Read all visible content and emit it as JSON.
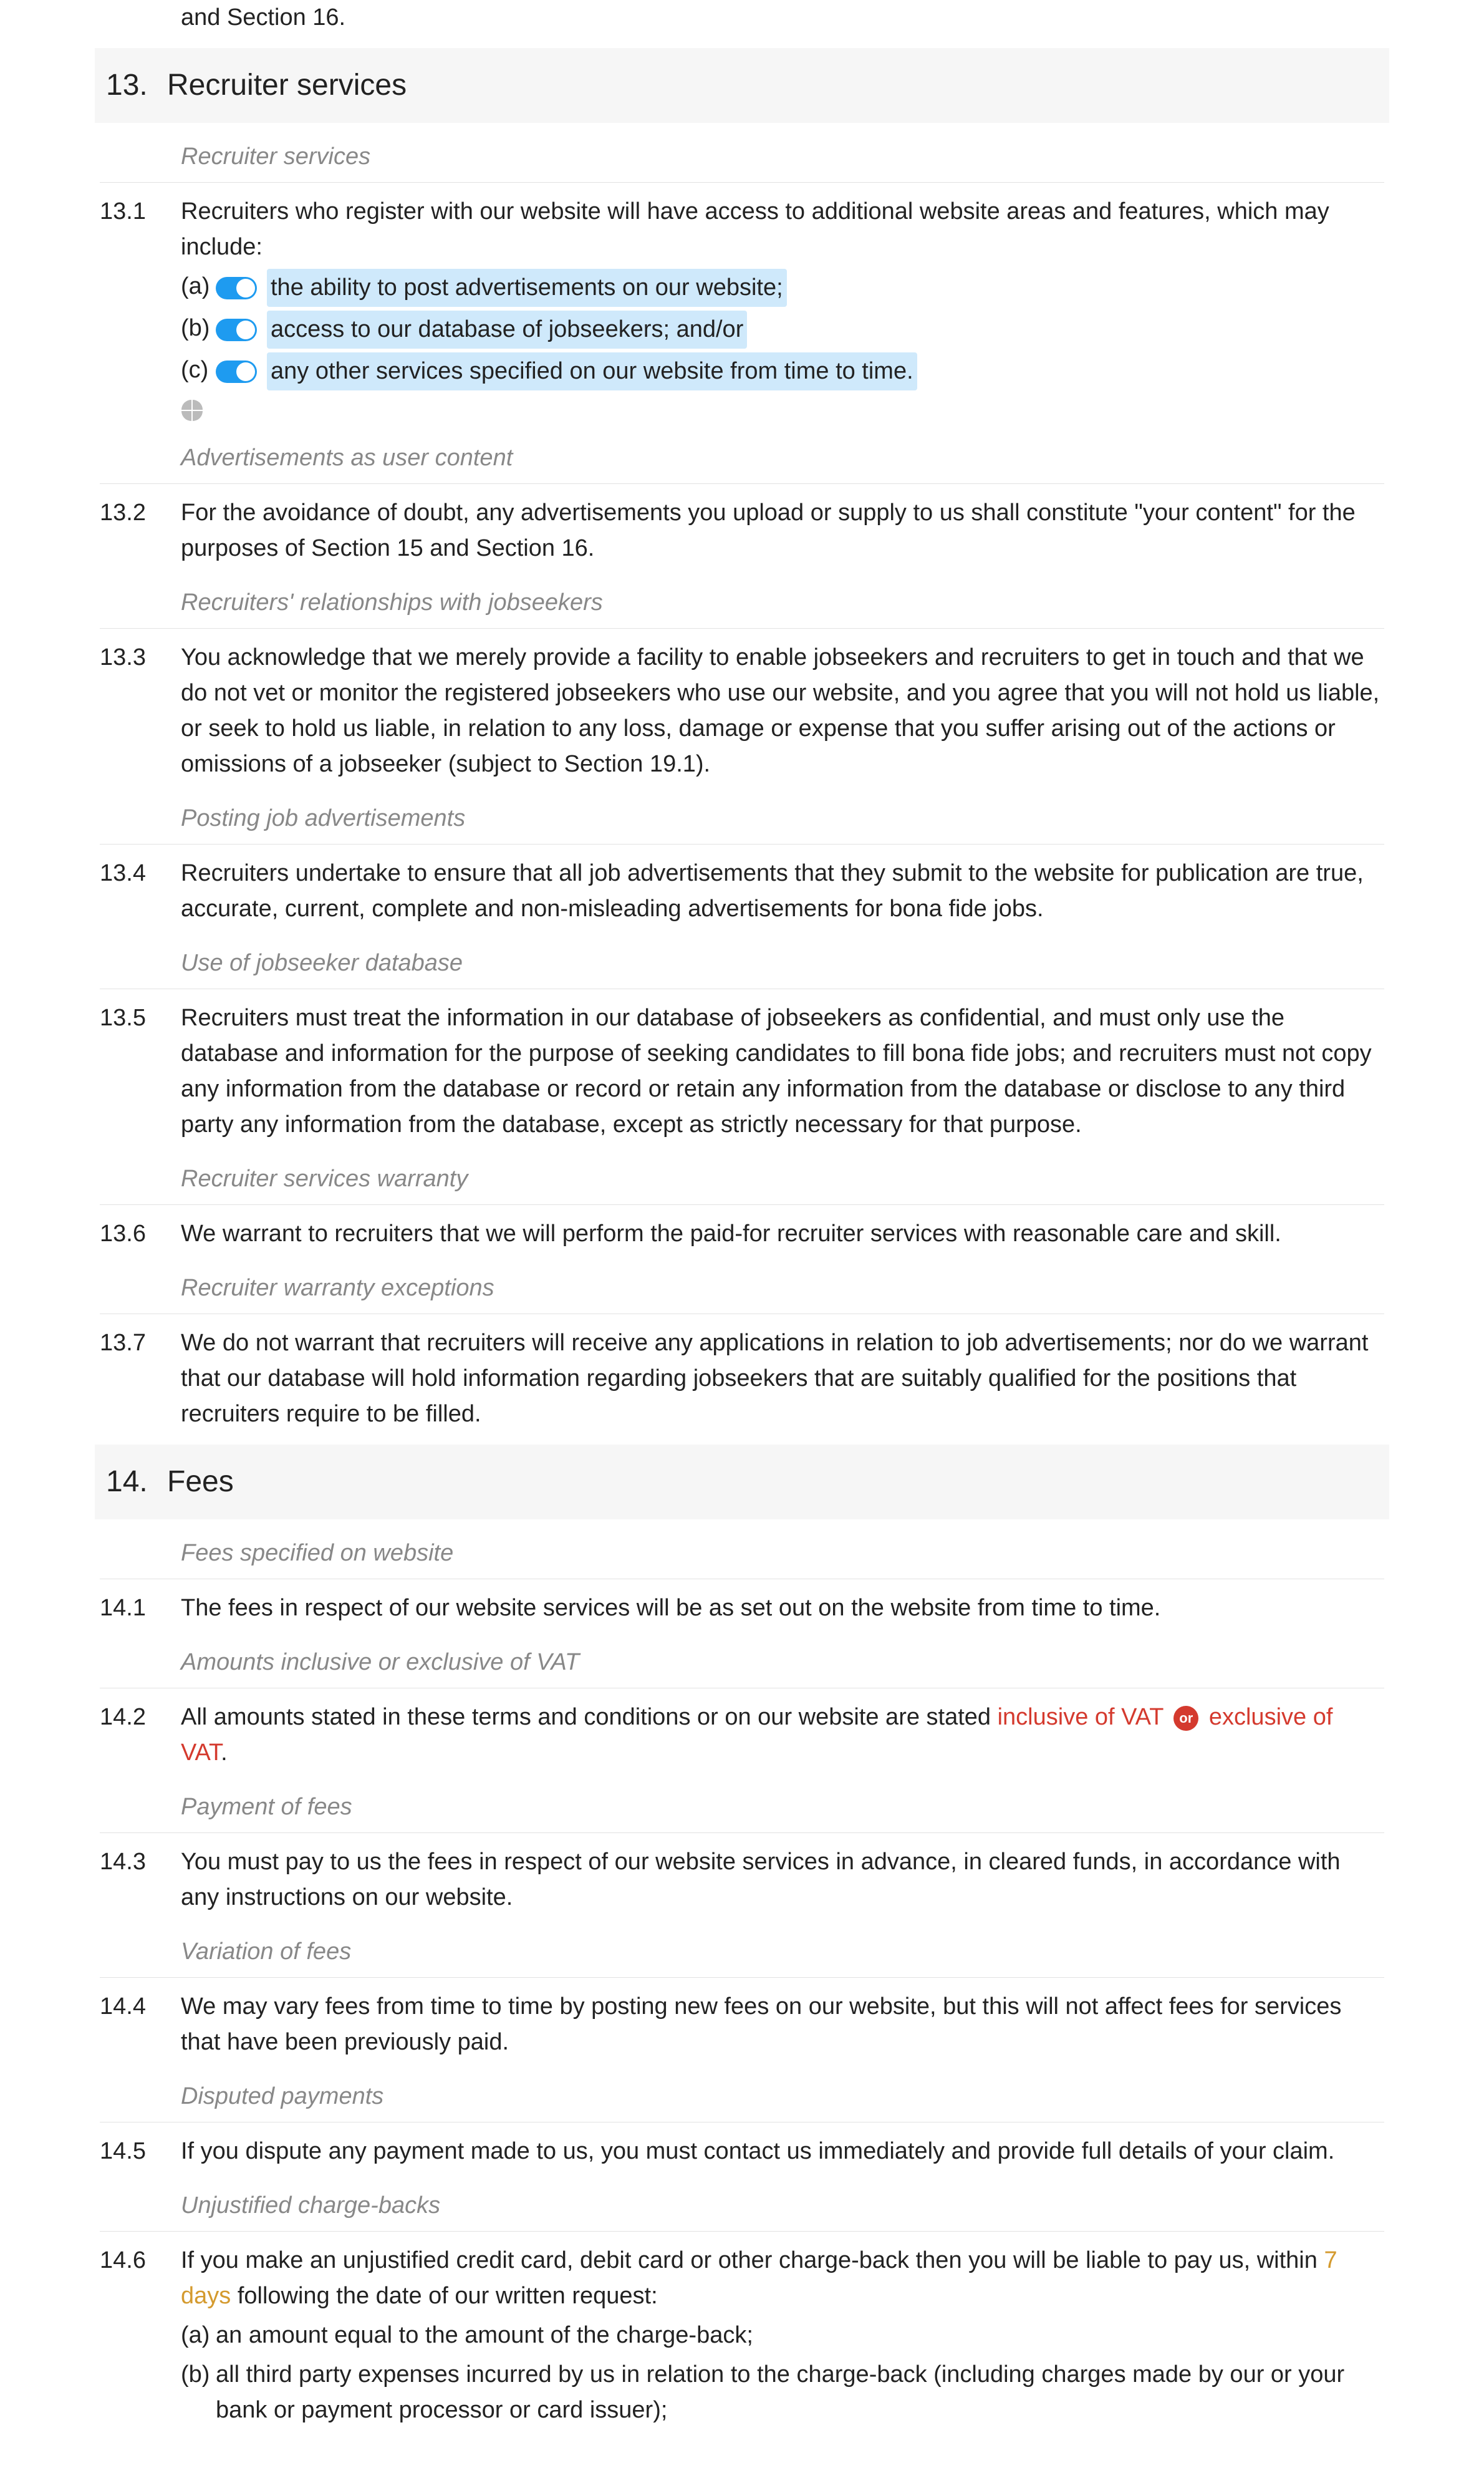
{
  "intro": {
    "tail": "and Section 16."
  },
  "s13": {
    "num": "13.",
    "title": "Recruiter services",
    "sub1": "Recruiter services",
    "c1": {
      "num": "13.1",
      "lead": "Recruiters who register with our website will have access to additional website areas and features, which may include:",
      "a_letter": "(a)",
      "a_text": "the ability to post advertisements on our website;",
      "b_letter": "(b)",
      "b_text": "access to our database of jobseekers; and/or",
      "c_letter": "(c)",
      "c_text": "any other services specified on our website from time to time."
    },
    "sub2": "Advertisements as user content",
    "c2": {
      "num": "13.2",
      "text": "For the avoidance of doubt, any advertisements you upload or supply to us shall constitute \"your content\" for the purposes of Section 15 and Section 16."
    },
    "sub3": "Recruiters' relationships with jobseekers",
    "c3": {
      "num": "13.3",
      "text": "You acknowledge that we merely provide a facility to enable jobseekers and recruiters to get in touch and that we do not vet or monitor the registered jobseekers who use our website, and you agree that you will not hold us liable, or seek to hold us liable, in relation to any loss, damage or expense that you suffer arising out of the actions or omissions of a jobseeker (subject to Section 19.1)."
    },
    "sub4": "Posting job advertisements",
    "c4": {
      "num": "13.4",
      "text": "Recruiters undertake to ensure that all job advertisements that they submit to the website for publication are true, accurate, current, complete and non-misleading advertisements for bona fide jobs."
    },
    "sub5": "Use of jobseeker database",
    "c5": {
      "num": "13.5",
      "text": "Recruiters must treat the information in our database of jobseekers as confidential, and must only use the database and information for the purpose of seeking candidates to fill bona fide jobs; and recruiters must not copy any information from the database or record or retain any information from the database or disclose to any third party any information from the database, except as strictly necessary for that purpose."
    },
    "sub6": "Recruiter services warranty",
    "c6": {
      "num": "13.6",
      "text": "We warrant to recruiters that we will perform the paid-for recruiter services with reasonable care and skill."
    },
    "sub7": "Recruiter warranty exceptions",
    "c7": {
      "num": "13.7",
      "text": "We do not warrant that recruiters will receive any applications in relation to job advertisements; nor do we warrant that our database will hold information regarding jobseekers that are suitably qualified for the positions that recruiters require to be filled."
    }
  },
  "s14": {
    "num": "14.",
    "title": "Fees",
    "sub1": "Fees specified on website",
    "c1": {
      "num": "14.1",
      "text": "The fees in respect of our website services will be as set out on the website from time to time."
    },
    "sub2": "Amounts inclusive or exclusive of VAT",
    "c2": {
      "num": "14.2",
      "pre": "All amounts stated in these terms and conditions or on our website are stated ",
      "opt1": "inclusive of VAT",
      "or": "or",
      "opt2": "exclusive of VAT",
      "post": "."
    },
    "sub3": "Payment of fees",
    "c3": {
      "num": "14.3",
      "text": "You must pay to us the fees in respect of our website services in advance, in cleared funds, in accordance with any instructions on our website."
    },
    "sub4": "Variation of fees",
    "c4": {
      "num": "14.4",
      "text": "We may vary fees from time to time by posting new fees on our website, but this will not affect fees for services that have been previously paid."
    },
    "sub5": "Disputed payments",
    "c5": {
      "num": "14.5",
      "text": "If you dispute any payment made to us, you must contact us immediately and provide full details of your claim."
    },
    "sub6": "Unjustified charge-backs",
    "c6": {
      "num": "14.6",
      "pre": "If you make an unjustified credit card, debit card or other charge-back then you will be liable to pay us, within ",
      "days": "7 days",
      "mid": " following the date of our written request:",
      "a_letter": "(a)",
      "a_text": "an amount equal to the amount of the charge-back;",
      "b_letter": "(b)",
      "b_text": "all third party expenses incurred by us in relation to the charge-back (including charges made by our or your bank or payment processor or card issuer);"
    }
  }
}
